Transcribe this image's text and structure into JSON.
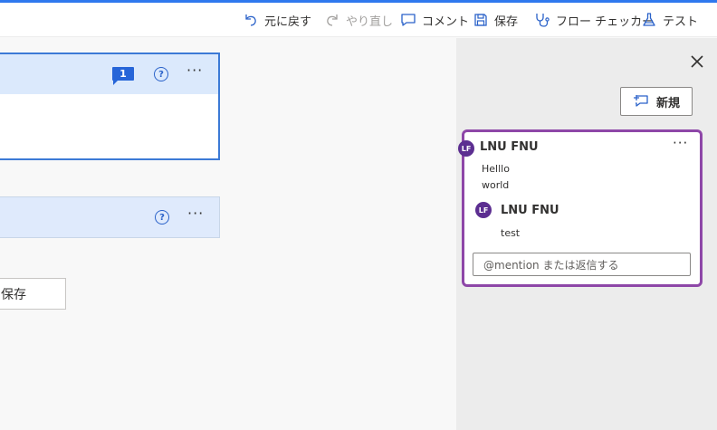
{
  "toolbar": {
    "undo_label": "元に戻す",
    "redo_label": "やり直し",
    "comment_label": "コメント",
    "save_label": "保存",
    "flow_checker_label": "フロー チェッカー",
    "test_label": "テスト"
  },
  "canvas": {
    "card1": {
      "comment_count": "1",
      "help_icon": "?",
      "more_icon": "···"
    },
    "card2": {
      "help_icon": "?",
      "more_icon": "···"
    },
    "save_button_label": "保存"
  },
  "comments_panel": {
    "new_button_label": "新規",
    "thread": {
      "author": "LNU FNU",
      "author_initials": "LF",
      "message_lines": [
        "Helllo",
        "world"
      ],
      "more_icon": "···",
      "reply": {
        "author": "LNU FNU",
        "author_initials": "LF",
        "message": "test"
      },
      "reply_placeholder": "@mention または返信する"
    }
  },
  "colors": {
    "accent": "#2f78ee",
    "card_header": "#dbe9fc",
    "thread_border": "#8e47a8",
    "avatar": "#5c2e91",
    "badge": "#2665d8"
  }
}
